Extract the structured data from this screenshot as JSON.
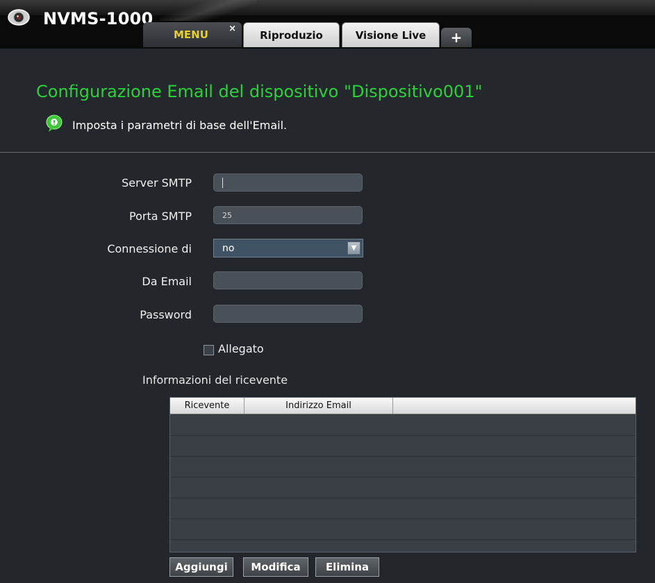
{
  "app": {
    "title": "NVMS-1000"
  },
  "tabs": [
    {
      "label": "MENU",
      "active": true,
      "close": "×"
    },
    {
      "label": "Riproduzio"
    },
    {
      "label": "Visione Live"
    },
    {
      "label": "+"
    }
  ],
  "header": {
    "title": "Configurazione Email del dispositivo \"Dispositivo001\"",
    "subtitle": "Imposta i parametri di base dell'Email."
  },
  "form": {
    "smtp_server": {
      "label": "Server SMTP",
      "value": ""
    },
    "smtp_port": {
      "label": "Porta SMTP",
      "value": "25"
    },
    "connection": {
      "label": "Connessione di",
      "value": "no"
    },
    "from_email": {
      "label": "Da Email",
      "value": ""
    },
    "password": {
      "label": "Password",
      "value": ""
    },
    "attachment": {
      "label": "Allegato",
      "checked": false
    }
  },
  "recipients": {
    "section_label": "Informazioni del ricevente",
    "columns": [
      "Ricevente",
      "Indirizzo Email"
    ],
    "rows": []
  },
  "buttons": {
    "add": "Aggiungi",
    "edit": "Modifica",
    "delete": "Elimina"
  },
  "colors": {
    "title_green": "#2bd13a",
    "active_tab_text": "#e8d028",
    "background": "#23272c"
  },
  "icons": {
    "logo": "webcam-icon",
    "info": "green-info-bubble-icon",
    "dropdown": "chevron-down-icon"
  }
}
